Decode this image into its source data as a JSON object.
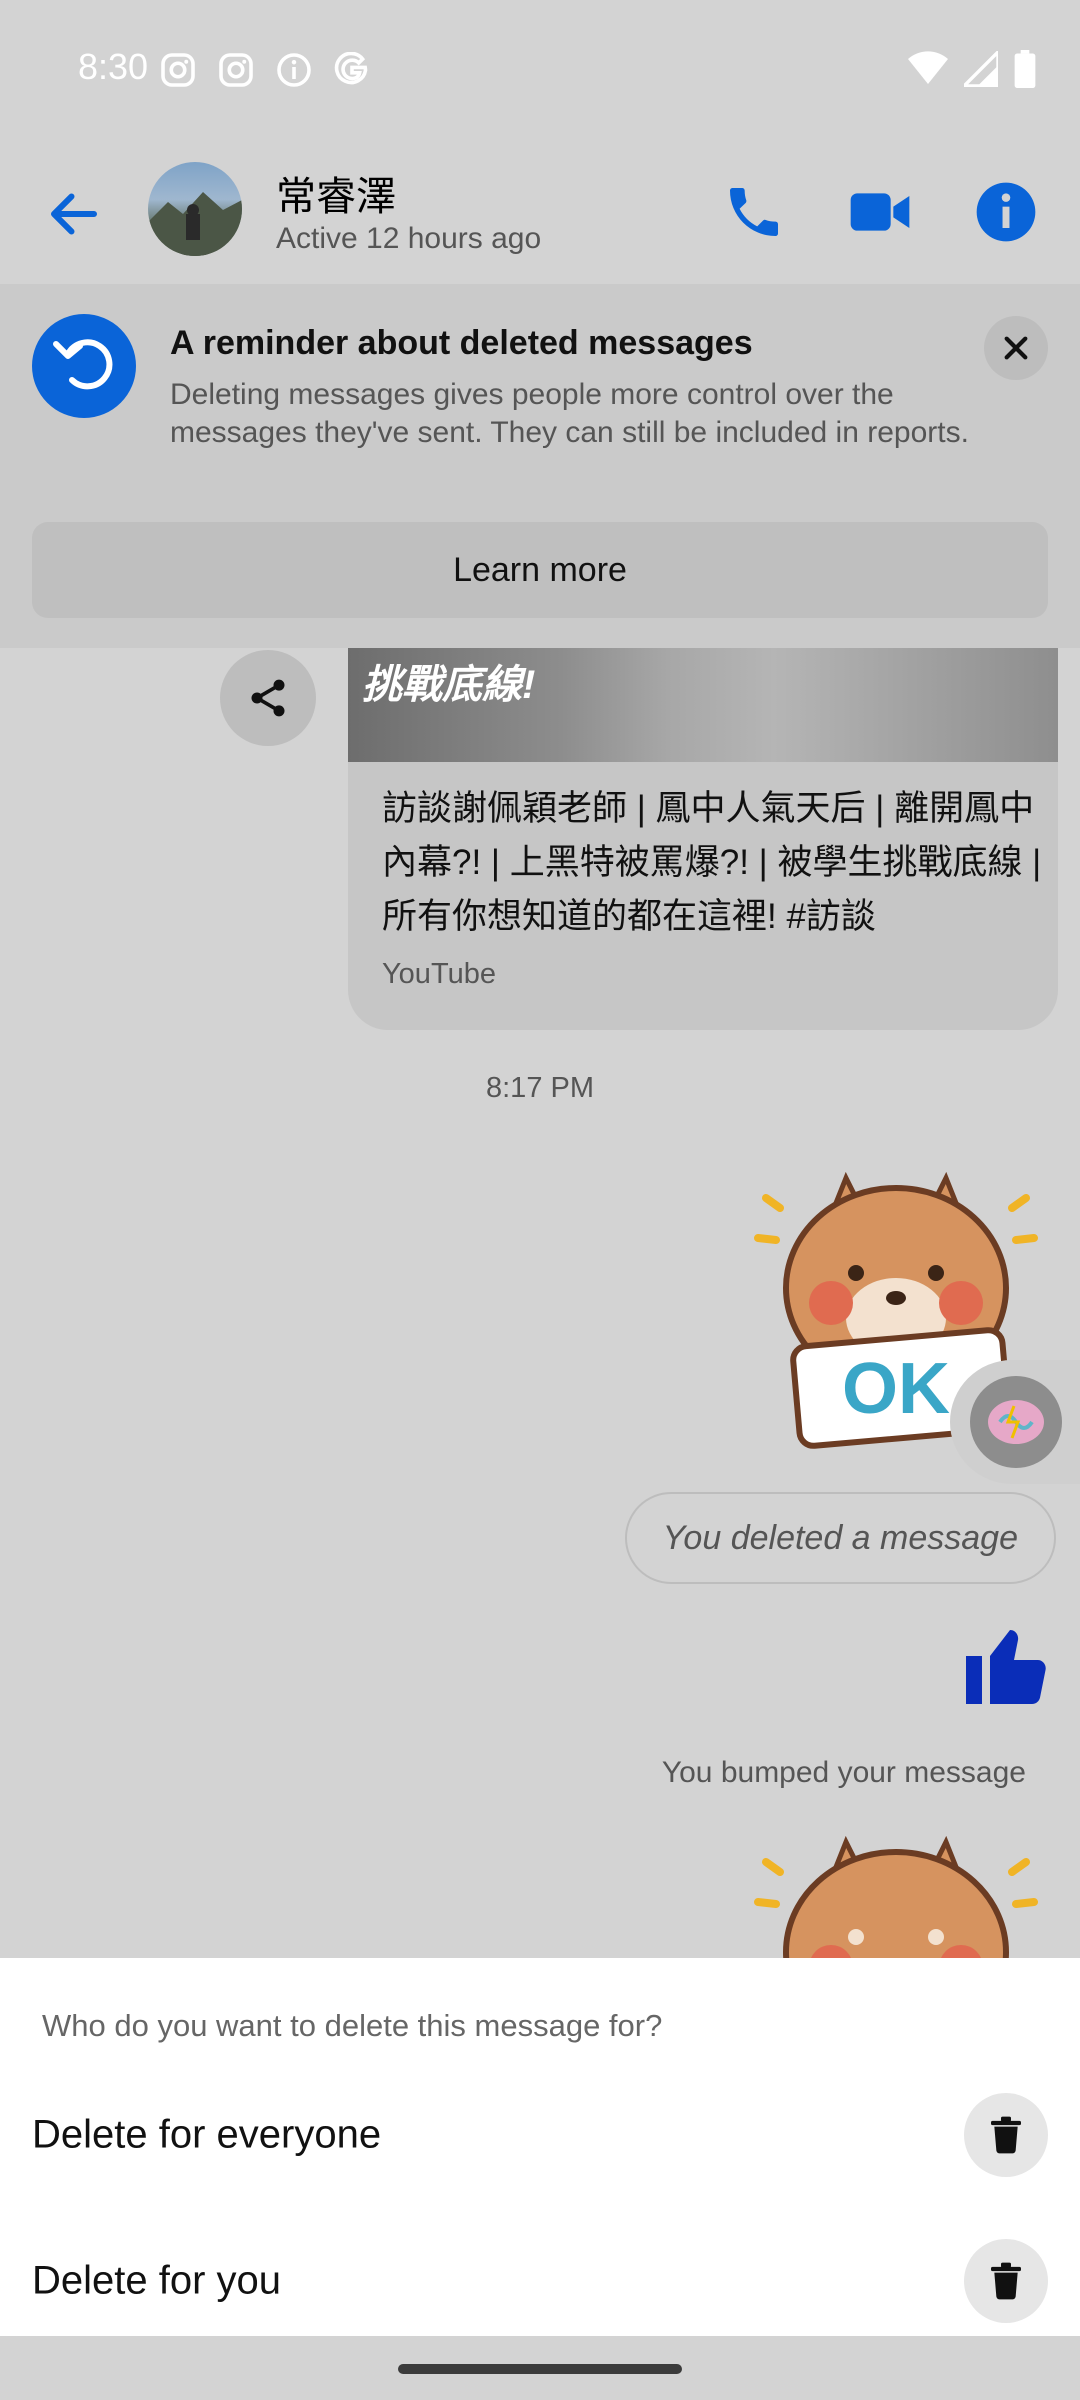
{
  "status_bar": {
    "time": "8:30",
    "icons": [
      "instagram-icon",
      "instagram-icon",
      "info-icon",
      "google-icon"
    ],
    "right_icons": [
      "wifi-icon",
      "signal-icon",
      "battery-icon"
    ]
  },
  "header": {
    "name": "常睿澤",
    "status": "Active 12 hours ago",
    "buttons": [
      "phone-icon",
      "video-icon",
      "info-icon"
    ],
    "accent": "#0a64d8"
  },
  "reminder": {
    "title": "A reminder about deleted messages",
    "body": "Deleting messages gives people more control over the messages they've sent. They can still be included in reports.",
    "learn_more": "Learn more"
  },
  "conversation": {
    "link_card": {
      "thumb_text": "挑戰底線!",
      "title": "訪談謝佩穎老師 | 鳳中人氣天后 | 離開鳳中內幕?! | 上黑特被罵爆?! | 被學生挑戰底線 | 所有你想知道的都在這裡! #訪談",
      "source": "YouTube"
    },
    "timestamp": "8:17 PM",
    "sticker_text": "OK",
    "deleted_text": "You deleted a message",
    "bumped_text": "You bumped your message"
  },
  "sheet": {
    "question": "Who do you want to delete this message for?",
    "options": [
      {
        "label": "Delete for everyone"
      },
      {
        "label": "Delete for you"
      }
    ]
  }
}
